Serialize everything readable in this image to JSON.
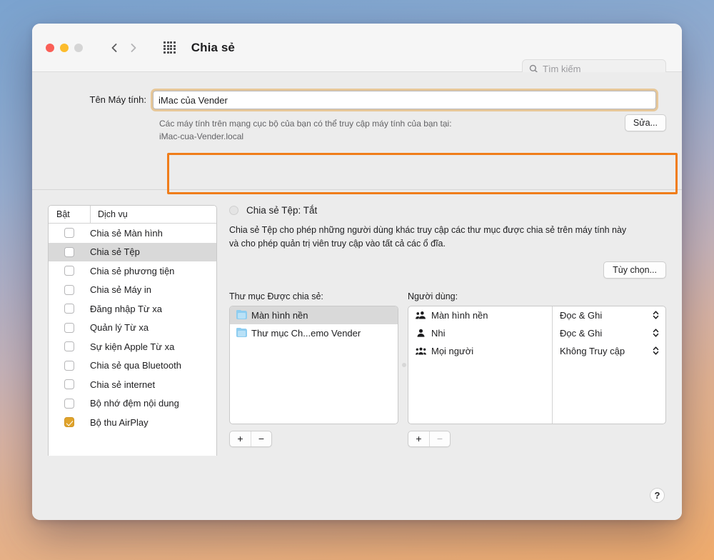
{
  "window": {
    "title": "Chia sẻ",
    "traffic_lights": [
      "close",
      "minimize",
      "zoom"
    ],
    "grid_icon": "grid-apps-icon",
    "back_icon": "chevron-left-icon",
    "forward_icon": "chevron-right-icon"
  },
  "search": {
    "placeholder": "Tìm kiếm",
    "icon": "search-icon"
  },
  "computer_name": {
    "label": "Tên Máy tính:",
    "value": "iMac của Vender",
    "hint_line1": "Các máy tính trên mạng cục bộ của bạn có thể truy cập máy tính của bạn tại:",
    "hint_line2": "iMac-cua-Vender.local",
    "edit_button": "Sửa...",
    "highlight_color": "#f07d1a",
    "focus_ring_color": "#e2aa56"
  },
  "services_table": {
    "col_on": "Bật",
    "col_service": "Dịch vụ",
    "rows": [
      {
        "label": "Chia sẻ Màn hình",
        "checked": false,
        "selected": false
      },
      {
        "label": "Chia sẻ Tệp",
        "checked": false,
        "selected": true
      },
      {
        "label": "Chia sẻ phương tiện",
        "checked": false,
        "selected": false
      },
      {
        "label": "Chia sẻ Máy in",
        "checked": false,
        "selected": false
      },
      {
        "label": "Đăng nhập Từ xa",
        "checked": false,
        "selected": false
      },
      {
        "label": "Quản lý Từ xa",
        "checked": false,
        "selected": false
      },
      {
        "label": "Sự kiện Apple Từ xa",
        "checked": false,
        "selected": false
      },
      {
        "label": "Chia sẻ qua Bluetooth",
        "checked": false,
        "selected": false
      },
      {
        "label": "Chia sẻ internet",
        "checked": false,
        "selected": false
      },
      {
        "label": "Bộ nhớ đệm nội dung",
        "checked": false,
        "selected": false
      },
      {
        "label": "Bộ thu AirPlay",
        "checked": true,
        "selected": false
      }
    ],
    "checked_color": "#e0a32b"
  },
  "detail": {
    "status": "Chia sẻ Tệp: Tắt",
    "description": "Chia sẻ Tệp cho phép những người dùng khác truy cập các thư mục được chia sẻ trên máy tính này và cho phép quản trị viên truy cập vào tất cả các ổ đĩa.",
    "options_button": "Tùy chọn...",
    "folders_label": "Thư mục Được chia sẻ:",
    "users_label": "Người dùng:"
  },
  "shared_folders": [
    {
      "name": "Màn hình nền",
      "selected": true,
      "icon": "folder-icon"
    },
    {
      "name": "Thư mục Ch...emo Vender",
      "selected": false,
      "icon": "folder-icon"
    }
  ],
  "users": [
    {
      "name": "Màn hình nền",
      "permission": "Đọc & Ghi",
      "icon": "group-icon"
    },
    {
      "name": "Nhi",
      "permission": "Đọc & Ghi",
      "icon": "person-icon"
    },
    {
      "name": "Mọi người",
      "permission": "Không Truy cập",
      "icon": "everyone-icon"
    }
  ],
  "folder_controls": {
    "add": "+",
    "remove": "−",
    "remove_disabled": false
  },
  "user_controls": {
    "add": "+",
    "remove": "−",
    "remove_disabled": true
  },
  "footer": {
    "help": "?"
  }
}
